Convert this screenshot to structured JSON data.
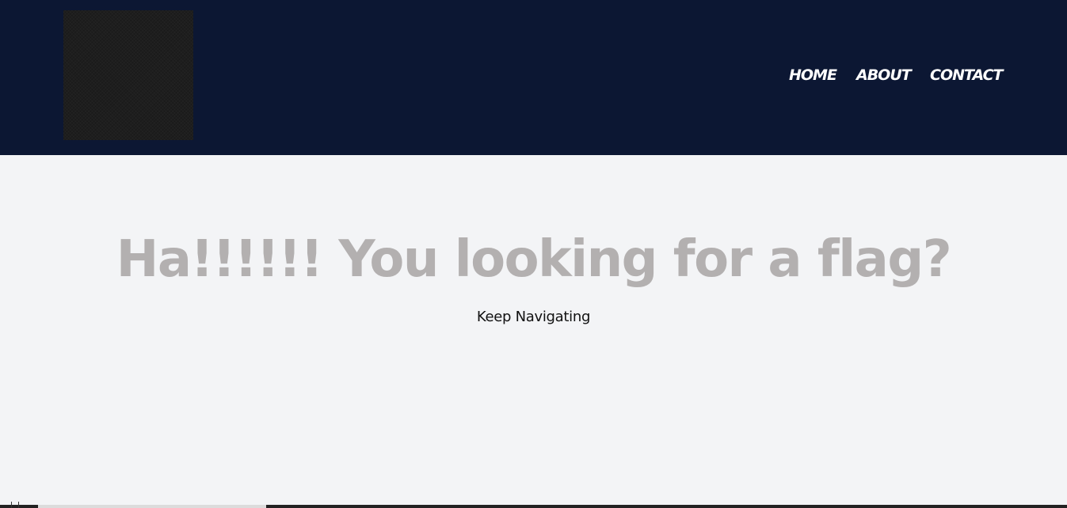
{
  "header": {
    "background_color": "#0c1733",
    "logo": {
      "icon": "logo-image",
      "color": "#1e1e1e"
    },
    "nav": [
      {
        "label": "HOME"
      },
      {
        "label": "ABOUT"
      },
      {
        "label": "CONTACT"
      }
    ]
  },
  "main": {
    "background_color": "#f3f4f6",
    "title": "Ha!!!!!! You looking for a flag?",
    "title_color": "#b3b0b0",
    "subtitle": "Keep Navigating"
  }
}
